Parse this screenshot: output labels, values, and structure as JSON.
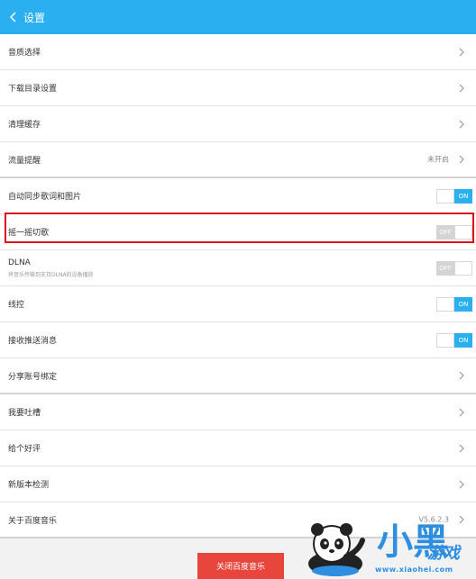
{
  "header": {
    "title": "设置"
  },
  "rows": [
    {
      "label": "音质选择"
    },
    {
      "label": "下载目录设置"
    },
    {
      "label": "清理缓存"
    },
    {
      "label": "流量提醒",
      "value": "未开启"
    },
    {
      "label": "自动同步歌词和图片",
      "toggle": "ON"
    },
    {
      "label": "摇一摇切歌",
      "toggle": "OFF"
    },
    {
      "label": "DLNA",
      "sub": "将音乐传输到支持DLNA的设备播放",
      "toggle": "OFF"
    },
    {
      "label": "线控",
      "toggle": "ON"
    },
    {
      "label": "接收推送消息",
      "toggle": "ON"
    },
    {
      "label": "分享账号绑定"
    },
    {
      "label": "我要吐槽"
    },
    {
      "label": "给个好评"
    },
    {
      "label": "新版本检测"
    },
    {
      "label": "关于百度音乐",
      "value": "V5.6.2.3"
    }
  ],
  "footer": {
    "close_button": "关闭百度音乐"
  },
  "watermark": {
    "brand": "小黑",
    "brand2": "游戏",
    "url": "www.xiaohei.com"
  },
  "colors": {
    "accent": "#2aaff0",
    "danger": "#e8453c",
    "highlight": "#d9141b"
  }
}
